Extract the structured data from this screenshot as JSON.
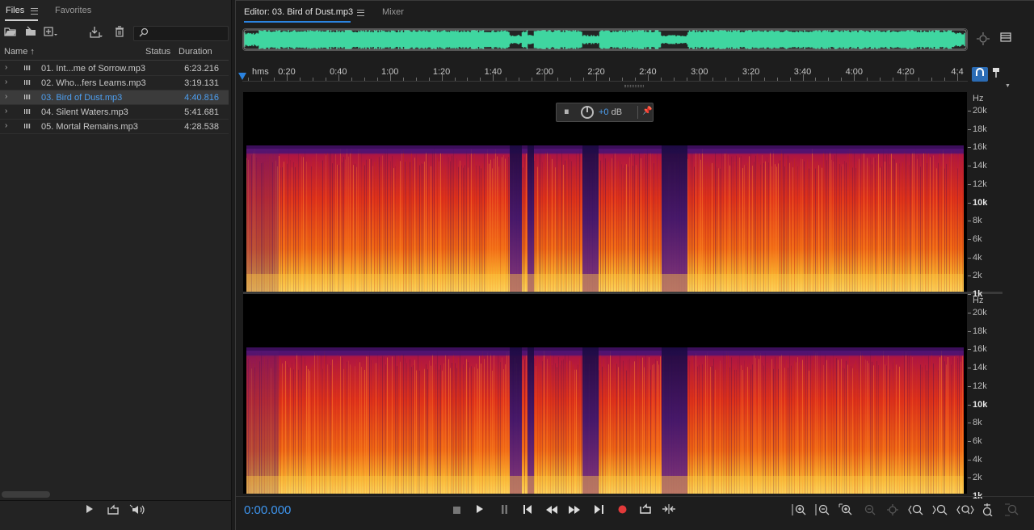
{
  "files_panel": {
    "tabs": [
      {
        "label": "Files"
      },
      {
        "label": "Favorites"
      }
    ],
    "search": {
      "placeholder": ""
    },
    "columns": {
      "name": "Name",
      "sort_arrow": "↑",
      "status": "Status",
      "duration": "Duration"
    },
    "files": [
      {
        "name": "01. Int...me of Sorrow.mp3",
        "status": "",
        "duration": "6:23.216",
        "selected": false
      },
      {
        "name": "02. Who...fers Learns.mp3",
        "status": "",
        "duration": "3:19.131",
        "selected": false
      },
      {
        "name": "03. Bird of Dust.mp3",
        "status": "",
        "duration": "4:40.816",
        "selected": true
      },
      {
        "name": "04. Silent Waters.mp3",
        "status": "",
        "duration": "5:41.681",
        "selected": false
      },
      {
        "name": "05. Mortal Remains.mp3",
        "status": "",
        "duration": "4:28.538",
        "selected": false
      }
    ],
    "icons": [
      "open-folder-icon",
      "import-icon",
      "new-file-icon",
      "insert-icon",
      "trash-icon",
      "search-icon",
      "play-icon",
      "loop-icon",
      "autoplay-icon"
    ]
  },
  "editor": {
    "tabs": [
      {
        "label": "Editor: 03. Bird of Dust.mp3"
      },
      {
        "label": "Mixer"
      }
    ],
    "ruler": {
      "unit": "hms",
      "labels": [
        "0:20",
        "0:40",
        "1:00",
        "1:20",
        "1:40",
        "2:00",
        "2:20",
        "2:40",
        "3:00",
        "3:20",
        "3:40",
        "4:00",
        "4:20",
        "4:4"
      ]
    },
    "hud": {
      "gain": "+0",
      "unit": "dB"
    },
    "frequency_axis": {
      "unit": "Hz",
      "labels": [
        "20k",
        "18k",
        "16k",
        "14k",
        "12k",
        "10k",
        "8k",
        "6k",
        "4k",
        "2k",
        "1k"
      ]
    },
    "current_time": "0:00.000",
    "accent_color": "#2b83e0",
    "waveform_color": "#3fd6a0"
  }
}
